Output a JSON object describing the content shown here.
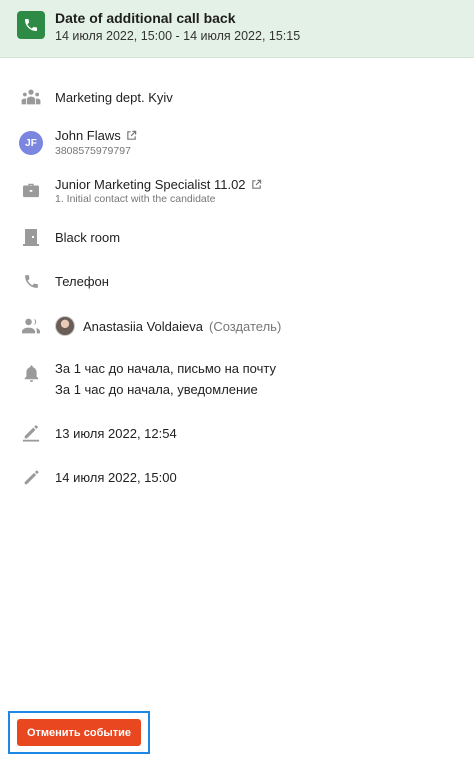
{
  "header": {
    "title": "Date of additional call back",
    "datetime": "14 июля 2022, 15:00 - 14 июля 2022, 15:15",
    "icon": "phone-icon",
    "accent_color": "#2e8b45",
    "background_color": "#e4f1e6"
  },
  "department": {
    "icon": "team-icon",
    "label": "Marketing dept. Kyiv"
  },
  "candidate": {
    "initials": "JF",
    "name": "John Flaws",
    "phone": "3808575979797",
    "avatar_color": "#7b86e0"
  },
  "vacancy": {
    "icon": "briefcase-icon",
    "title": "Junior Marketing Specialist 11.02",
    "stage": "1. Initial contact with the candidate"
  },
  "room": {
    "icon": "door-icon",
    "label": "Black room"
  },
  "call_type": {
    "icon": "phone-icon",
    "label": "Телефон"
  },
  "participant": {
    "icon": "users-icon",
    "name": "Anastasiia Voldaieva",
    "role": "(Создатель)"
  },
  "reminders": {
    "icon": "bell-icon",
    "items": [
      "За 1 час до начала, письмо на почту",
      "За 1 час до начала, уведомление"
    ]
  },
  "created": {
    "icon": "edit-icon",
    "label": "13 июля 2022, 12:54"
  },
  "updated": {
    "icon": "pencil-icon",
    "label": "14 июля 2022, 15:00"
  },
  "actions": {
    "cancel_label": "Отменить событие",
    "cancel_color": "#e8471f",
    "highlight_color": "#1e88e5"
  }
}
